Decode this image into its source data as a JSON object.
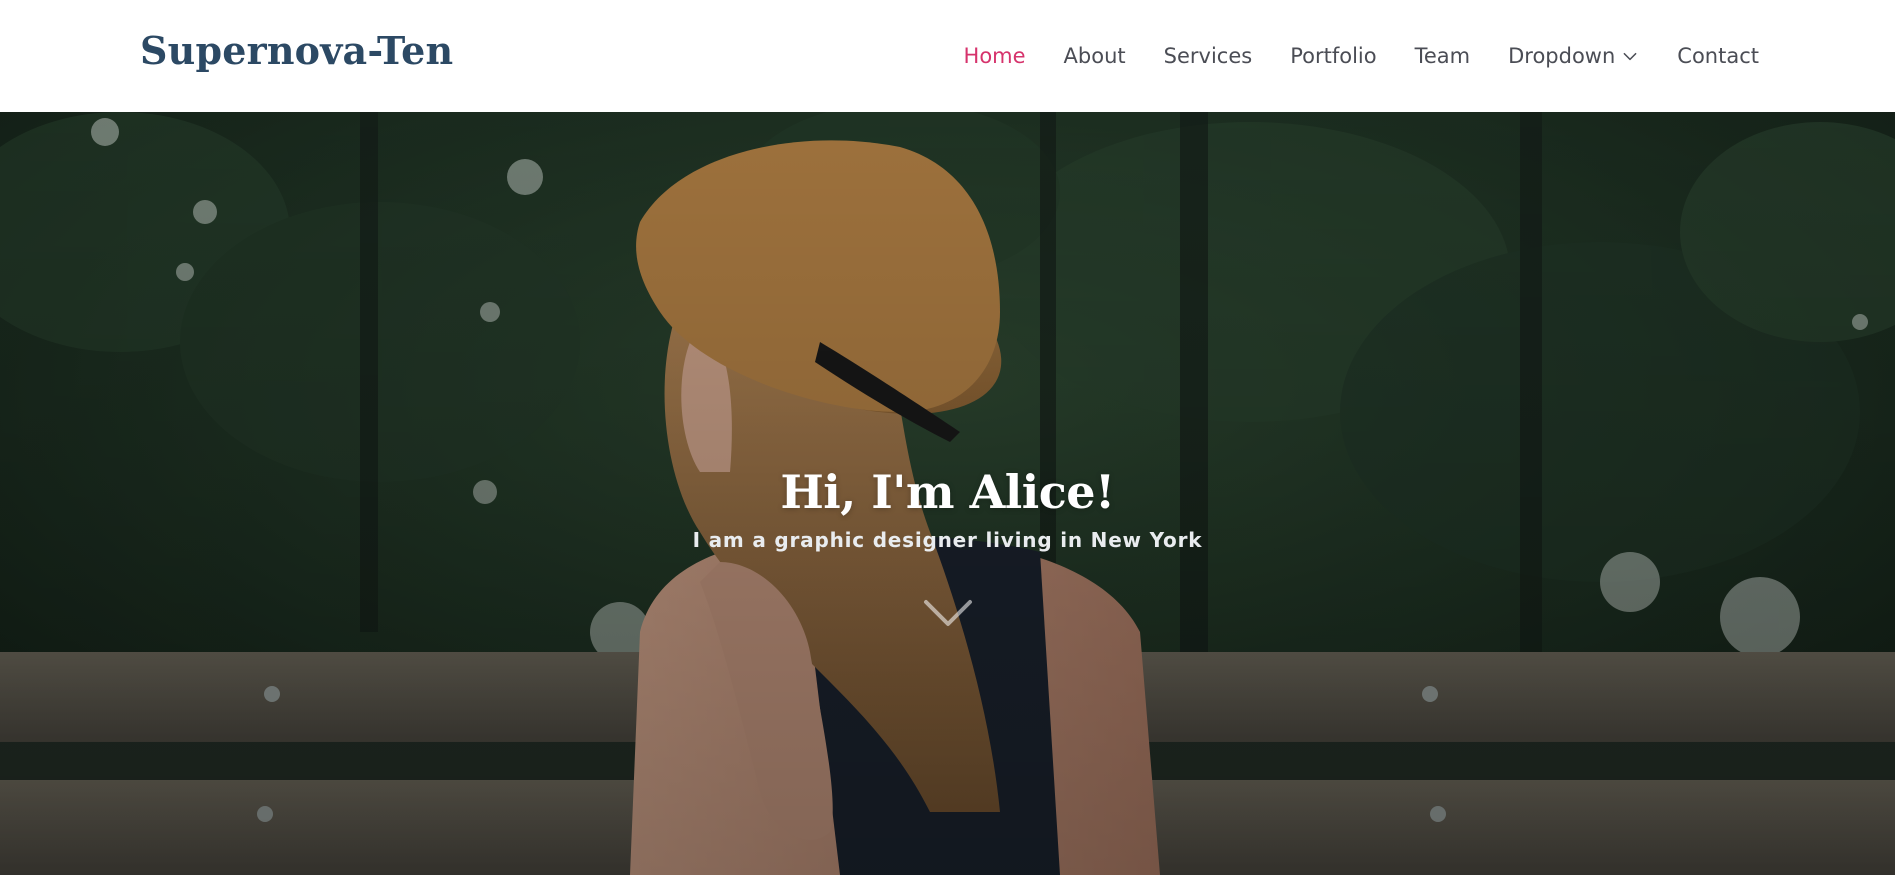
{
  "brand": {
    "logo_text": "Supernova-Ten"
  },
  "nav": {
    "items": [
      {
        "label": "Home",
        "active": true
      },
      {
        "label": "About"
      },
      {
        "label": "Services"
      },
      {
        "label": "Portfolio"
      },
      {
        "label": "Team"
      },
      {
        "label": "Dropdown",
        "icon": "chevron-down-icon"
      },
      {
        "label": "Contact"
      }
    ]
  },
  "hero": {
    "title": "Hi, I'm Alice!",
    "subtitle": "I am a graphic designer living in New York",
    "scroll_icon": "chevron-down-icon"
  },
  "colors": {
    "accent": "#d6336c",
    "logo": "#2c4964",
    "nav_text": "#4b4d55"
  }
}
